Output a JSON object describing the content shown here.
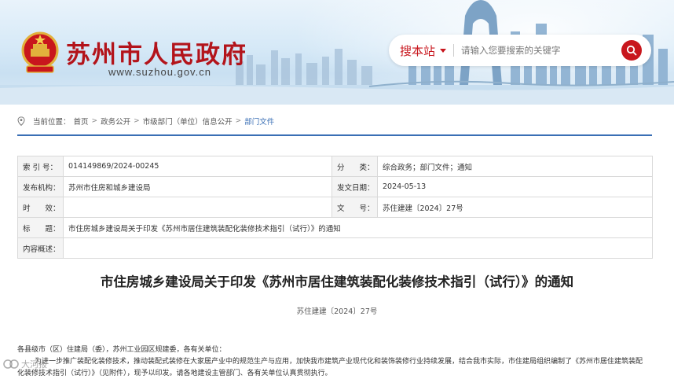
{
  "header": {
    "site_title": "苏州市人民政府",
    "site_url": "www.suzhou.gov.cn",
    "logo_icon": "national-emblem-icon",
    "brand_color": "#b3141b"
  },
  "search": {
    "scope_label": "搜本站",
    "placeholder": "请输入您要搜索的关键字",
    "button_icon": "search-icon"
  },
  "breadcrumb": {
    "prefix": "当前位置：",
    "items": [
      "首页",
      "政务公开",
      "市级部门（单位）信息公开",
      "部门文件"
    ],
    "separator": ">"
  },
  "info": {
    "index_label": "索 引 号：",
    "index_value": "014149869/2024-00245",
    "category_label": "分　　类：",
    "category_value": "综合政务；部门文件；通知",
    "publisher_label": "发布机构：",
    "publisher_value": "苏州市住房和城乡建设局",
    "date_label": "发文日期：",
    "date_value": "2024-05-13",
    "validity_label": "时　　效：",
    "validity_value": "",
    "docno_label": "文　　号：",
    "docno_value": "苏住建建〔2024〕27号",
    "title_label": "标　　题：",
    "title_value": "市住房城乡建设局关于印发《苏州市居住建筑装配化装修技术指引（试行）》的通知",
    "summary_label": "内容概述：",
    "summary_value": ""
  },
  "document": {
    "title": "市住房城乡建设局关于印发《苏州市居住建筑装配化装修技术指引（试行）》的通知",
    "number": "苏住建建〔2024〕27号",
    "salutation": "各县级市（区）住建局（委），苏州工业园区规建委，各有关单位：",
    "para1_line1": "为进一步推广装配化装修技术，推动装配式装修在大家居产业中的规范生产与应用，加快我市建筑产业现代化和装饰装修行业持续发展，结合我市实际，市住建局组织编制了《苏州市居住建筑装配",
    "para1_line2": "化装修技术指引（试行）》（见附件），现予以印发。请各地建设主管部门、各有关单位认真贯彻执行。"
  },
  "watermark": {
    "text": "大河报"
  }
}
